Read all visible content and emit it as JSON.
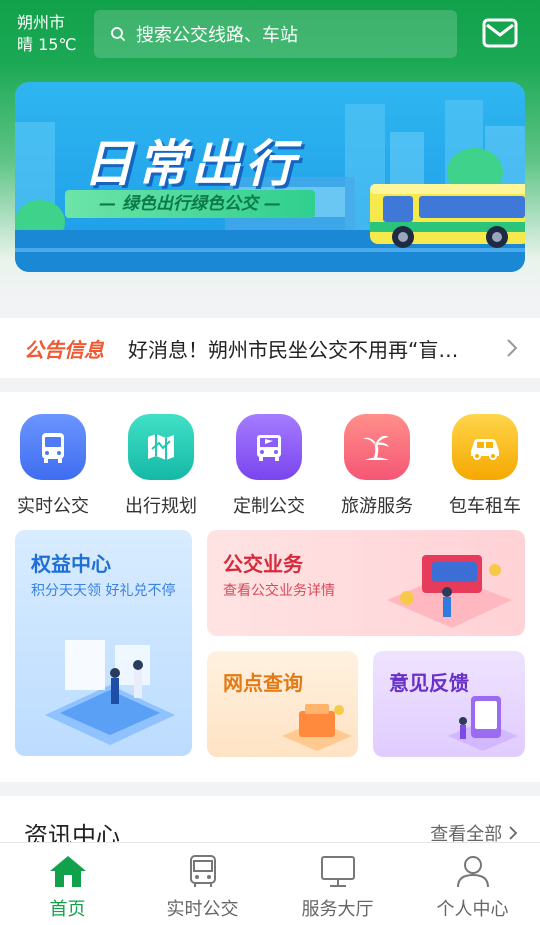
{
  "header": {
    "city": "朔州市",
    "weather": "晴 15℃",
    "search_placeholder": "搜索公交线路、车站"
  },
  "banner": {
    "title": "日常出行",
    "subtitle": "— 绿色出行绿色公交 —"
  },
  "notice": {
    "tag": "公告信息",
    "text": "好消息！朔州市民坐公交不用再“盲等”啦"
  },
  "services": [
    {
      "label": "实时公交",
      "icon": "bus-icon",
      "color": "#4f7bf7"
    },
    {
      "label": "出行规划",
      "icon": "map-icon",
      "color": "#1fc7b5"
    },
    {
      "label": "定制公交",
      "icon": "custom-bus-icon",
      "color": "#8b5cf6"
    },
    {
      "label": "旅游服务",
      "icon": "palm-tree-icon",
      "color": "#f9647a"
    },
    {
      "label": "包车租车",
      "icon": "car-icon",
      "color": "#f7b500"
    }
  ],
  "cards": {
    "rights": {
      "title": "权益中心",
      "subtitle": "积分天天领 好礼兑不停"
    },
    "bus_business": {
      "title": "公交业务",
      "subtitle": "查看公交业务详情"
    },
    "outlets": {
      "title": "网点查询"
    },
    "feedback": {
      "title": "意见反馈"
    }
  },
  "news": {
    "title": "资讯中心",
    "more": "查看全部"
  },
  "tabs": [
    {
      "label": "首页",
      "icon": "home-icon",
      "active": true
    },
    {
      "label": "实时公交",
      "icon": "bus-icon",
      "active": false
    },
    {
      "label": "服务大厅",
      "icon": "monitor-icon",
      "active": false
    },
    {
      "label": "个人中心",
      "icon": "user-icon",
      "active": false
    }
  ],
  "colors": {
    "brand_green": "#12a14b",
    "notice_orange": "#f05a33"
  }
}
